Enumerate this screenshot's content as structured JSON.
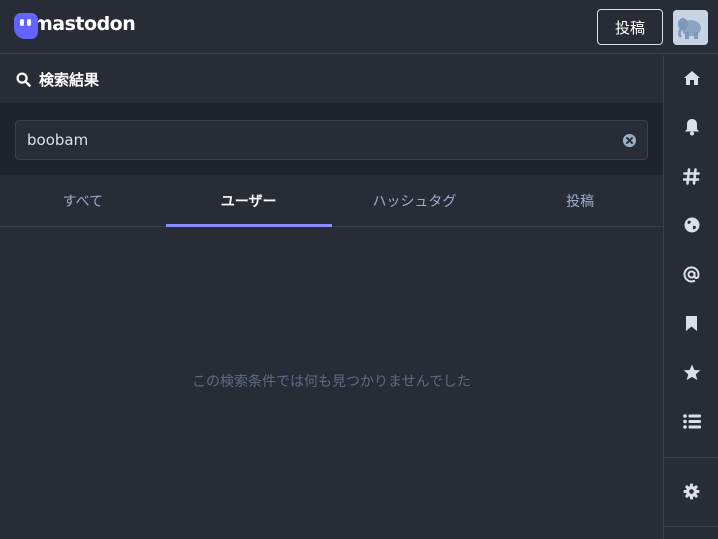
{
  "app": {
    "logo_text": "mastodon"
  },
  "header": {
    "post_button_label": "投稿"
  },
  "column": {
    "title": "検索結果"
  },
  "search": {
    "value": "boobam"
  },
  "tabs": [
    {
      "label": "すべて",
      "active": false
    },
    {
      "label": "ユーザー",
      "active": true
    },
    {
      "label": "ハッシュタグ",
      "active": false
    },
    {
      "label": "投稿",
      "active": false
    }
  ],
  "empty_message": "この検索条件では何も見つかりませんでした",
  "nav_rail": [
    "home-icon",
    "bell-icon",
    "hashtag-icon",
    "globe-icon",
    "at-icon",
    "bookmark-icon",
    "star-icon",
    "list-icon",
    "gear-icon"
  ],
  "colors": {
    "background": "#282c37",
    "accent": "#8c8dff",
    "muted": "#606984",
    "tab_text": "#9baec8"
  }
}
